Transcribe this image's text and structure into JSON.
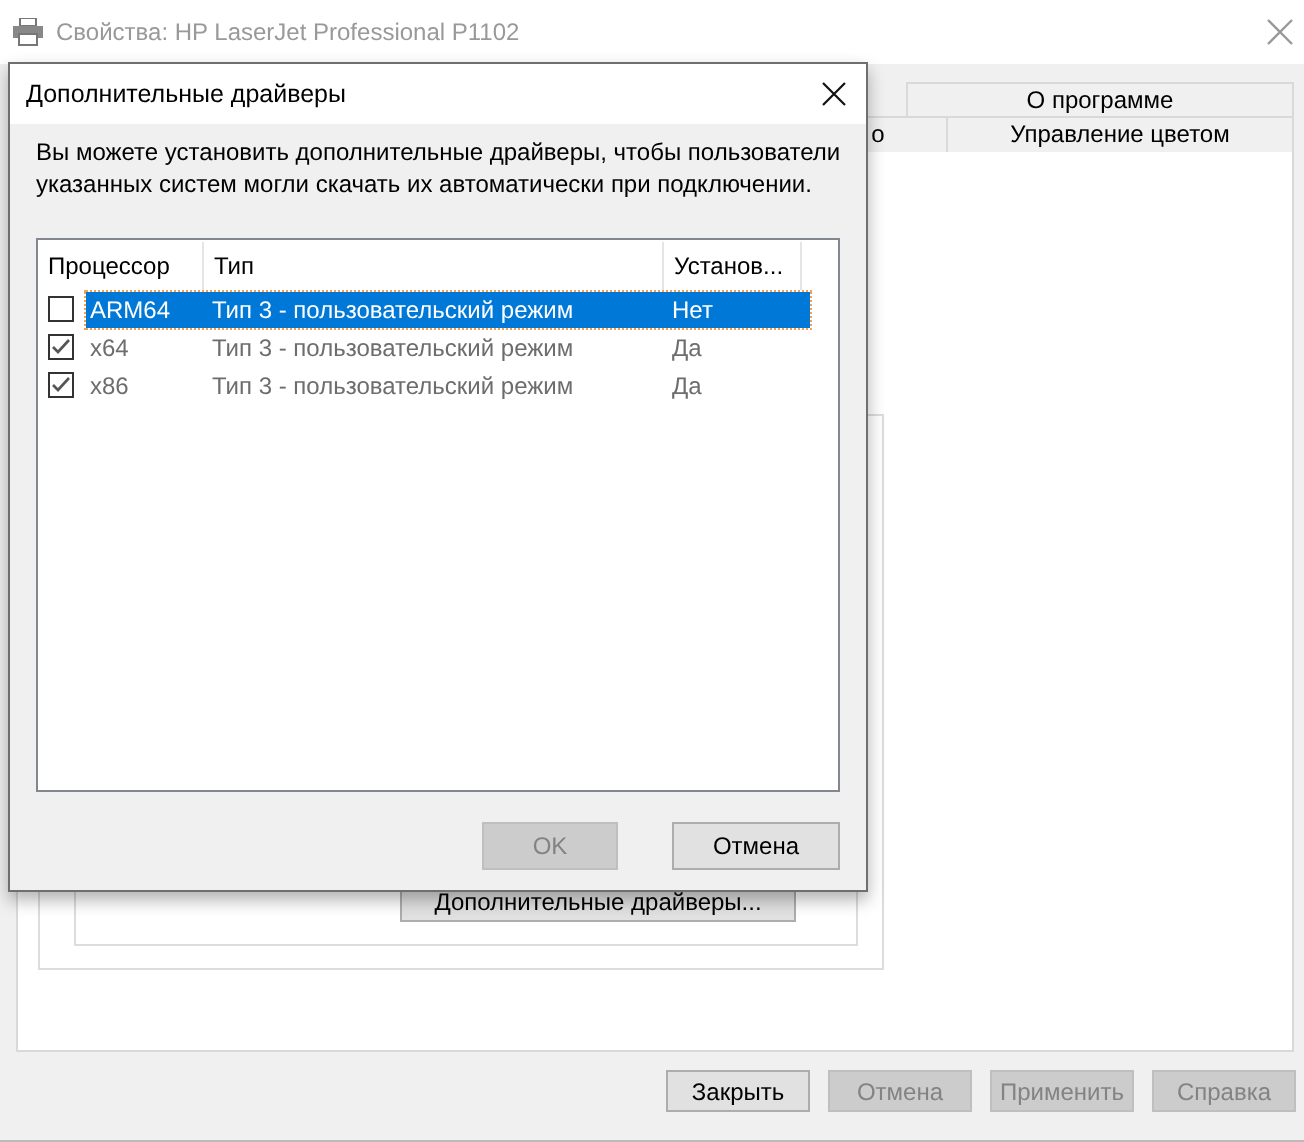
{
  "window": {
    "title": "Свойства: HP LaserJet Professional P1102"
  },
  "tabs": [
    [
      {
        "label": "О программе",
        "selected": false
      }
    ],
    [
      {
        "label": "о",
        "selected": false
      },
      {
        "label": "Управление цветом",
        "selected": false
      }
    ]
  ],
  "panel_button": {
    "label": "Дополнительные драйверы..."
  },
  "buttons": [
    {
      "label": "Закрыть",
      "disabled": false
    },
    {
      "label": "Отмена",
      "disabled": true
    },
    {
      "label": "Применить",
      "disabled": true
    },
    {
      "label": "Справка",
      "disabled": true
    }
  ],
  "dialog": {
    "title": "Дополнительные драйверы",
    "description": "Вы можете установить дополнительные драйверы, чтобы пользователи указанных систем могли скачать их автоматически при подключении.",
    "columns": [
      "Процессор",
      "Тип",
      "Установ..."
    ],
    "rows": [
      {
        "processor": "ARM64",
        "type": "Тип 3 - пользовательский режим",
        "installed": "Нет",
        "checked": false,
        "selected": true
      },
      {
        "processor": "x64",
        "type": "Тип 3 - пользовательский режим",
        "installed": "Да",
        "checked": true,
        "selected": false
      },
      {
        "processor": "x86",
        "type": "Тип 3 - пользовательский режим",
        "installed": "Да",
        "checked": true,
        "selected": false
      }
    ],
    "buttons": [
      {
        "label": "OK",
        "disabled": true
      },
      {
        "label": "Отмена",
        "disabled": false
      }
    ]
  }
}
